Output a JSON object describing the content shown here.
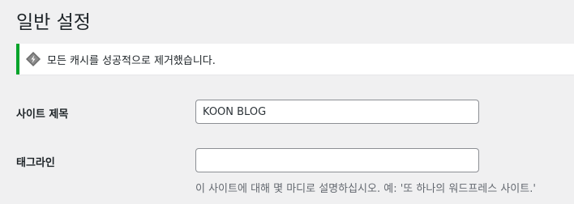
{
  "page": {
    "title": "일반 설정"
  },
  "notice": {
    "icon": "litespeed-diamond-icon",
    "message": "모든 캐시를 성공적으로 제거했습니다.",
    "accent_color": "#00a32a"
  },
  "fields": {
    "site_title": {
      "label": "사이트 제목",
      "value": "KOON BLOG"
    },
    "tagline": {
      "label": "태그라인",
      "value": "",
      "description": "이 사이트에 대해 몇 마디로 설명하십시오. 예: '또 하나의 워드프레스 사이트.'"
    }
  }
}
